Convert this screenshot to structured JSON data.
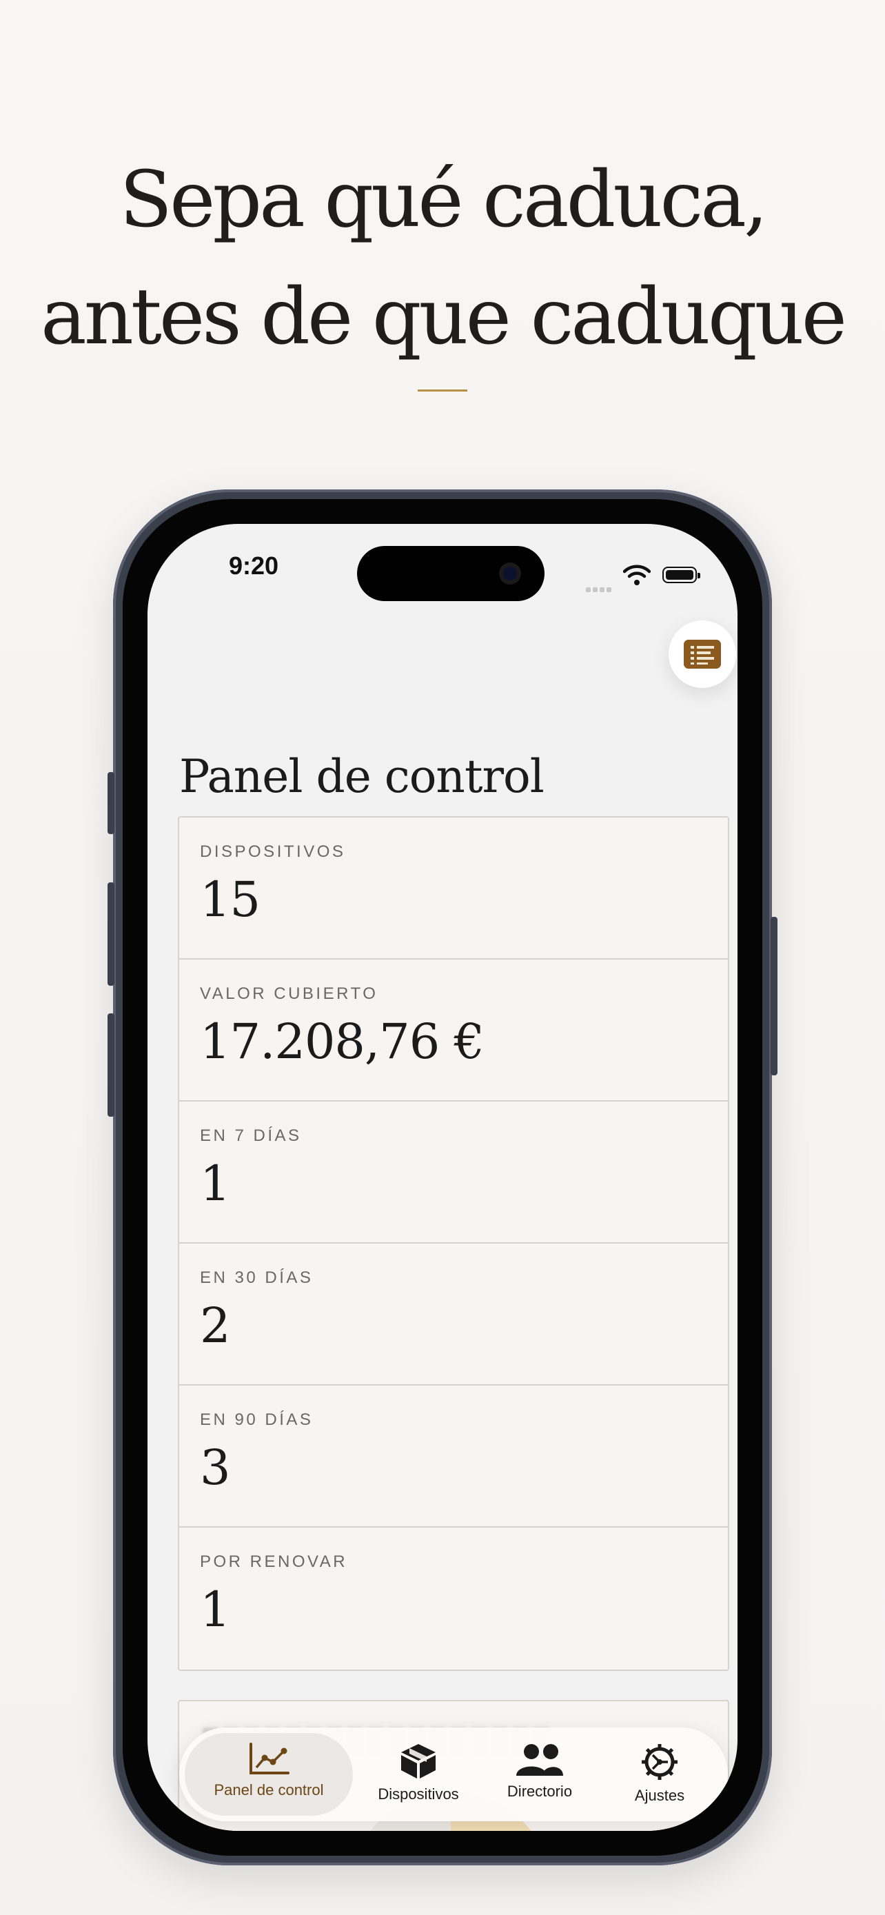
{
  "marketing": {
    "headline_line1": "Sepa qué caduca,",
    "headline_line2": "antes de que caduque"
  },
  "status_bar": {
    "time": "9:20"
  },
  "colors": {
    "accent": "#8a5a1e",
    "accent_text": "#6c4614",
    "rule": "#b88f45"
  },
  "page": {
    "title": "Panel de control"
  },
  "stats": [
    {
      "label": "DISPOSITIVOS",
      "value": "15"
    },
    {
      "label": "VALOR CUBIERTO",
      "value": "17.208,76 €"
    },
    {
      "label": "EN 7 DÍAS",
      "value": "1"
    },
    {
      "label": "EN 30 DÍAS",
      "value": "2"
    },
    {
      "label": "EN 90 DÍAS",
      "value": "3"
    },
    {
      "label": "POR RENOVAR",
      "value": "1"
    }
  ],
  "tabs": [
    {
      "label": "Panel de control",
      "icon": "chart-line-icon",
      "active": true
    },
    {
      "label": "Dispositivos",
      "icon": "box-icon",
      "active": false
    },
    {
      "label": "Directorio",
      "icon": "people-icon",
      "active": false
    },
    {
      "label": "Ajustes",
      "icon": "gear-icon",
      "active": false
    }
  ]
}
